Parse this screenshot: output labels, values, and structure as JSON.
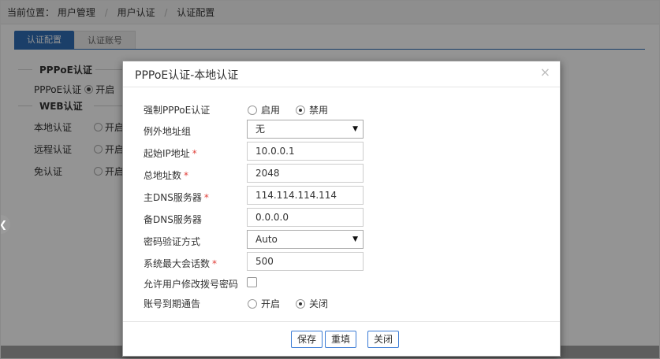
{
  "breadcrumb": {
    "prefix": "当前位置：",
    "items": [
      "用户管理",
      "用户认证",
      "认证配置"
    ],
    "separator": "/"
  },
  "tabs": [
    {
      "label": "认证配置",
      "active": true
    },
    {
      "label": "认证账号",
      "active": false
    }
  ],
  "background": {
    "pppoe_section": "PPPoE认证",
    "pppoe_row": {
      "label": "PPPoE认证",
      "option": "开启"
    },
    "web_section": "WEB认证",
    "rows": [
      {
        "label": "本地认证",
        "option": "开启"
      },
      {
        "label": "远程认证",
        "option": "开启"
      },
      {
        "label": "免认证",
        "option": "开启"
      }
    ]
  },
  "modal": {
    "title": "PPPoE认证-本地认证",
    "close_glyph": "×",
    "force_pppoe": {
      "label": "强制PPPoE认证",
      "options": [
        "启用",
        "禁用"
      ],
      "selected": "禁用"
    },
    "exception_group": {
      "label": "例外地址组",
      "value": "无"
    },
    "start_ip": {
      "label": "起始IP地址",
      "value": "10.0.0.1",
      "required_mark": "*"
    },
    "total_addresses": {
      "label": "总地址数",
      "value": "2048",
      "required_mark": "*"
    },
    "primary_dns": {
      "label": "主DNS服务器",
      "value": "114.114.114.114",
      "required_mark": "*"
    },
    "secondary_dns": {
      "label": "备DNS服务器",
      "value": "0.0.0.0"
    },
    "password_auth": {
      "label": "密码验证方式",
      "value": "Auto"
    },
    "max_sessions": {
      "label": "系统最大会话数",
      "value": "500",
      "required_mark": "*"
    },
    "allow_modify_password": {
      "label": "允许用户修改拨号密码",
      "checked": false
    },
    "expiry_notice": {
      "label": "账号到期通告",
      "options": [
        "开启",
        "关闭"
      ],
      "selected": "关闭"
    },
    "buttons": {
      "save": "保存",
      "reset": "重填",
      "close": "关闭"
    }
  },
  "colors": {
    "accent": "#2f6db5",
    "required": "#e0413b",
    "button_border": "#3a7bd5"
  },
  "icons": {
    "close": "close-icon",
    "caret": "caret-down-icon",
    "side": "chevron-left-icon"
  }
}
